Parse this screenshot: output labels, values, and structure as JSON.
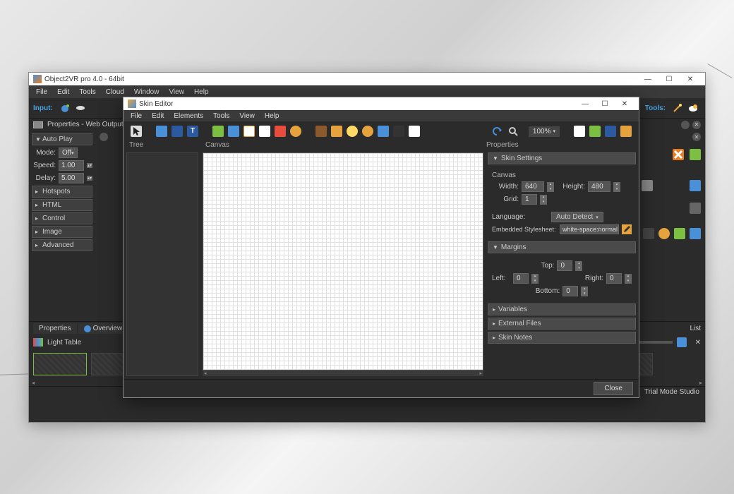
{
  "main": {
    "title": "Object2VR pro 4.0 - 64bit",
    "menu": [
      "File",
      "Edit",
      "Tools",
      "Cloud",
      "Window",
      "View",
      "Help"
    ],
    "input_label": "Input:",
    "tools_label": "Tools:",
    "properties_title": "Properties - Web Output",
    "autoplay": {
      "header": "Auto Play",
      "mode_label": "Mode:",
      "mode_value": "Off",
      "speed_label": "Speed:",
      "speed_value": "1.00",
      "delay_label": "Delay:",
      "delay_value": "5.00"
    },
    "sections": [
      "Hotspots",
      "HTML",
      "Control",
      "Image",
      "Advanced"
    ],
    "bottom_tabs": [
      "Properties",
      "Overview"
    ],
    "light_table_label": "Light Table",
    "output_list_label": "List",
    "status": "Trial Mode Studio"
  },
  "skin": {
    "title": "Skin Editor",
    "menu": [
      "File",
      "Edit",
      "Elements",
      "Tools",
      "View",
      "Help"
    ],
    "zoom": "100%",
    "columns": {
      "tree": "Tree",
      "canvas": "Canvas",
      "properties": "Properties"
    },
    "settings": {
      "header": "Skin Settings",
      "canvas_label": "Canvas",
      "width_label": "Width:",
      "width_value": "640",
      "height_label": "Height:",
      "height_value": "480",
      "grid_label": "Grid:",
      "grid_value": "1",
      "language_label": "Language:",
      "language_value": "Auto Detect",
      "stylesheet_label": "Embedded Stylesheet:",
      "stylesheet_value": "white-space:normal }"
    },
    "margins": {
      "header": "Margins",
      "top_label": "Top:",
      "top_value": "0",
      "left_label": "Left:",
      "left_value": "0",
      "right_label": "Right:",
      "right_value": "0",
      "bottom_label": "Bottom:",
      "bottom_value": "0"
    },
    "extra_sections": [
      "Variables",
      "External Files",
      "Skin Notes"
    ],
    "close_label": "Close"
  }
}
